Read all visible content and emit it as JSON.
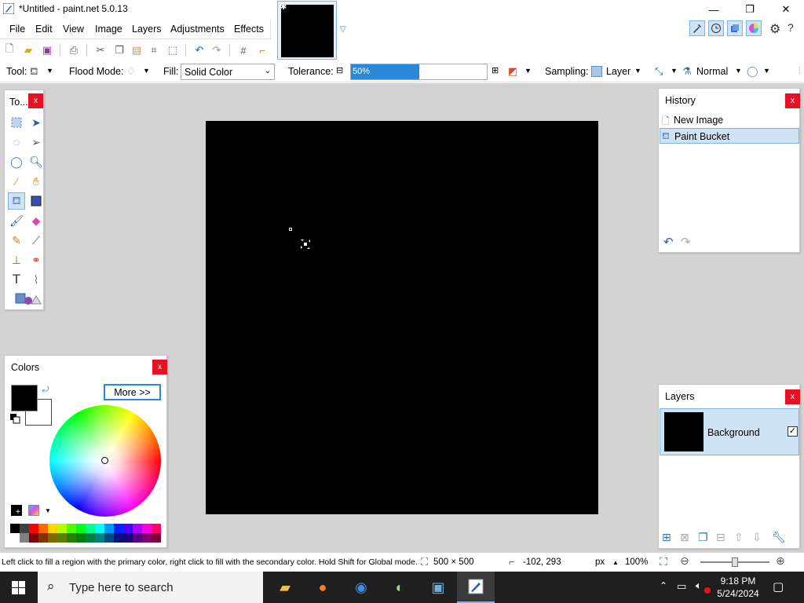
{
  "window": {
    "title": "*Untitled - paint.net 5.0.13",
    "min": "—",
    "restore": "❐",
    "close": "✕"
  },
  "menu": [
    "File",
    "Edit",
    "View",
    "Image",
    "Layers",
    "Adjustments",
    "Effects"
  ],
  "toolbar": {
    "tool_label": "Tool:",
    "flood_mode_label": "Flood Mode:",
    "fill_label": "Fill:",
    "fill_value": "Solid Color",
    "tolerance_label": "Tolerance:",
    "tolerance_value": "50%",
    "tolerance_fraction": 0.5,
    "sampling_label": "Sampling:",
    "sampling_value": "Layer",
    "blend_value": "Normal"
  },
  "tools_panel": {
    "title": "To...",
    "close": "x"
  },
  "colors_panel": {
    "title": "Colors",
    "close": "x",
    "more_button": "More >>"
  },
  "history_panel": {
    "title": "History",
    "close": "x",
    "items": [
      "New Image",
      "Paint Bucket"
    ]
  },
  "layers_panel": {
    "title": "Layers",
    "close": "x",
    "layers": [
      {
        "name": "Background",
        "visible": true
      }
    ]
  },
  "status": {
    "hint": "Left click to fill a region with the primary color, right click to fill with the secondary color. Hold Shift for Global mode.",
    "image_size": "500 × 500",
    "cursor_pos": "-102, 293",
    "units": "px",
    "zoom": "100%"
  },
  "taskbar": {
    "search_placeholder": "Type here to search",
    "time": "9:18 PM",
    "date": "5/24/2024"
  },
  "colors": {
    "accent": "#2b88d8",
    "selection_bg": "#cfe3f6",
    "selection_border": "#7fb2e5",
    "workspace_bg": "#d3d3d3",
    "canvas": "#000000",
    "close_red": "#e81123"
  }
}
